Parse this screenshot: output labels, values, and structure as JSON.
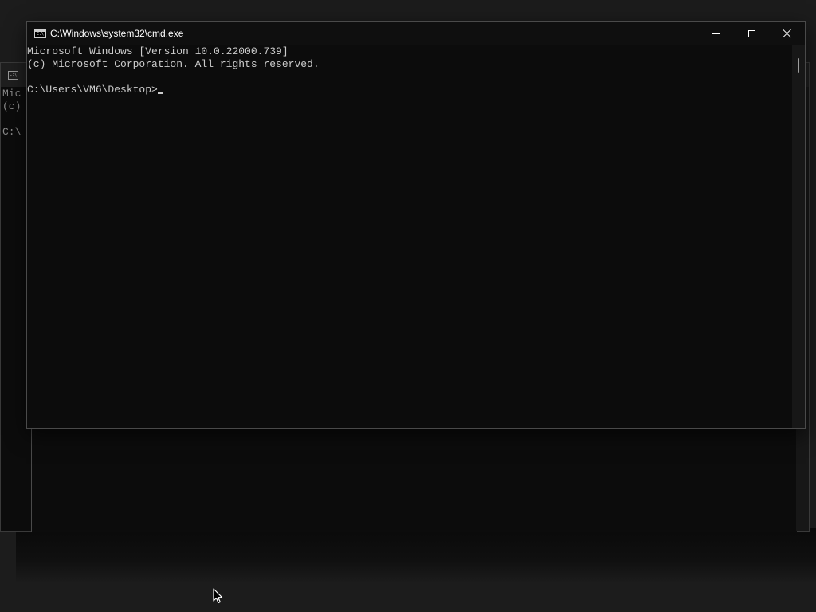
{
  "window": {
    "title": "C:\\Windows\\system32\\cmd.exe"
  },
  "background_window": {
    "text_lines": [
      "Mic",
      "(c)",
      "",
      "C:\\"
    ]
  },
  "console": {
    "lines": [
      "Microsoft Windows [Version 10.0.22000.739]",
      "(c) Microsoft Corporation. All rights reserved.",
      "",
      "C:\\Users\\VM6\\Desktop>"
    ]
  },
  "colors": {
    "console_background": "#0c0c0c",
    "console_foreground": "#cccccc",
    "titlebar": "#0f0f0f"
  },
  "icons": {
    "app": "cmd-app-icon",
    "minimize": "minimize-icon",
    "maximize": "maximize-icon",
    "close": "close-icon",
    "pointer": "mouse-pointer-icon"
  }
}
